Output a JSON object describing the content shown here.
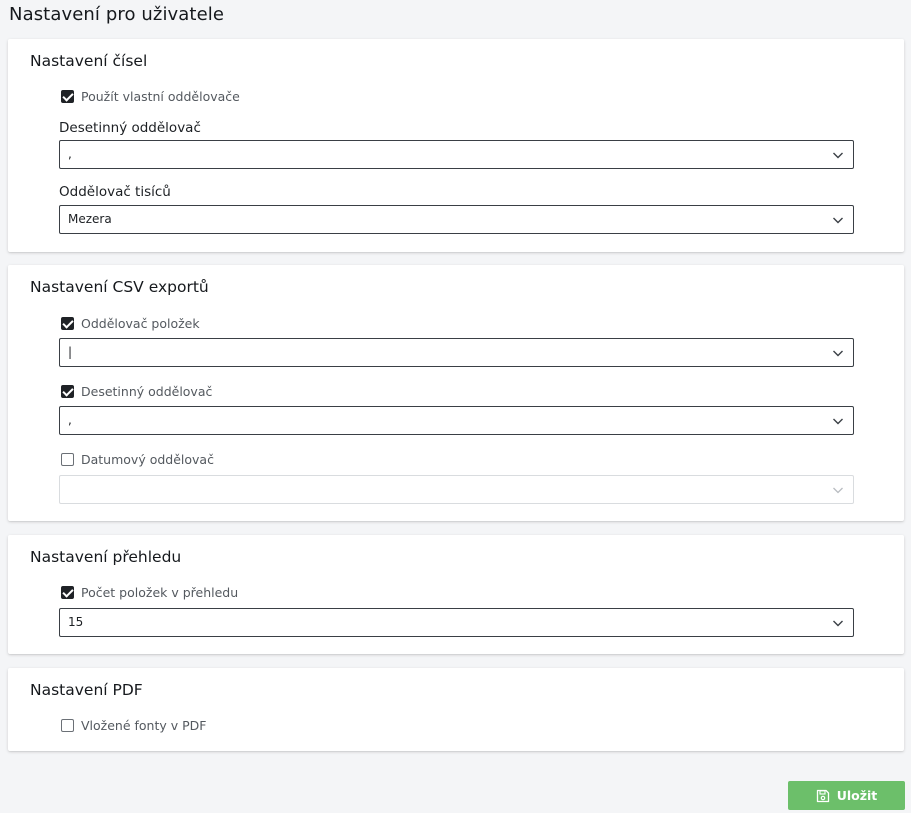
{
  "page": {
    "title": "Nastavení pro uživatele"
  },
  "numbers": {
    "title": "Nastavení čísel",
    "custom_separators": {
      "label": "Použít vlastní oddělovače",
      "checked": true
    },
    "decimal_separator": {
      "label": "Desetinný oddělovač",
      "value": ","
    },
    "thousands_separator": {
      "label": "Oddělovač tisíců",
      "value": "Mezera"
    }
  },
  "csv": {
    "title": "Nastavení CSV exportů",
    "item_separator": {
      "label": "Oddělovač položek",
      "checked": true,
      "value": "|"
    },
    "decimal_separator": {
      "label": "Desetinný oddělovač",
      "checked": true,
      "value": ","
    },
    "date_separator": {
      "label": "Datumový oddělovač",
      "checked": false,
      "value": ""
    }
  },
  "overview": {
    "title": "Nastavení přehledu",
    "items_count": {
      "label": "Počet položek v přehledu",
      "checked": true,
      "value": "15"
    }
  },
  "pdf": {
    "title": "Nastavení PDF",
    "embedded_fonts": {
      "label": "Vložené fonty v PDF",
      "checked": false
    }
  },
  "actions": {
    "save_label": "Uložit",
    "save_icon": "floppy-disk-icon",
    "save_color": "#6cbf6a"
  },
  "colors": {
    "background": "#f4f5f7",
    "card": "#ffffff",
    "checkbox_checked": "#1f2226"
  }
}
